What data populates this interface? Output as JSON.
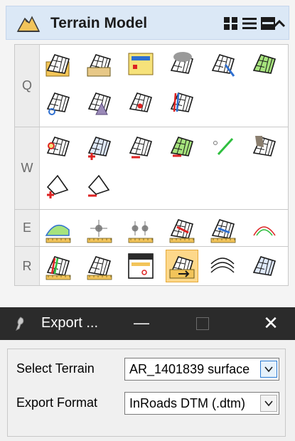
{
  "panel": {
    "title": "Terrain Model",
    "header_icon": "terrain-mountain-icon",
    "header_buttons": [
      "large-icons-view-icon",
      "list-view-icon",
      "ribbon-view-icon",
      "collapse-up-icon"
    ],
    "groups": [
      {
        "label": "Q",
        "tools": [
          "terrain-from-file-icon",
          "terrain-from-graphics-icon",
          "terrain-from-element-icon",
          "terrain-from-point-cloud-icon",
          "terrain-filter-icon",
          "terrain-complex-icon",
          "clip-terrain-icon",
          "terrain-from-elevation-icon",
          "terrain-by-text-icon",
          "merge-terrain-icon"
        ]
      },
      {
        "label": "W",
        "tools": [
          "add-feature-icon",
          "add-point-icon",
          "delete-point-icon",
          "edit-elevation-icon",
          "create-line-icon",
          "swap-edge-icon",
          "add-boundary-icon",
          "remove-boundary-icon"
        ]
      },
      {
        "label": "E",
        "tools": [
          "profile-analysis-icon",
          "analyze-point-icon",
          "analyze-points-icon",
          "drape-element-icon",
          "drape-line-icon",
          "contour-analysis-icon"
        ]
      },
      {
        "label": "R",
        "tools": [
          "terrain-report-icon",
          "crossing-report-icon",
          "terrain-dialog-report-icon",
          "export-terrain-icon",
          "label-contours-icon",
          "label-spot-icon"
        ]
      }
    ],
    "active_tool": "export-terrain-icon"
  },
  "dialog": {
    "title": "Export ...",
    "icon": "app-settings-icon",
    "minimize_glyph": "—",
    "close_glyph": "✕",
    "fields": {
      "terrain": {
        "label": "Select Terrain",
        "value": "AR_1401839 surface"
      },
      "format": {
        "label": "Export Format",
        "value": "InRoads DTM (.dtm)"
      }
    }
  },
  "colors": {
    "accent": "#2a7bd4",
    "header_bg": "#dbe8f6",
    "active_tool_bg": "#fdd88a",
    "titlebar_bg": "#2b2b2b"
  }
}
